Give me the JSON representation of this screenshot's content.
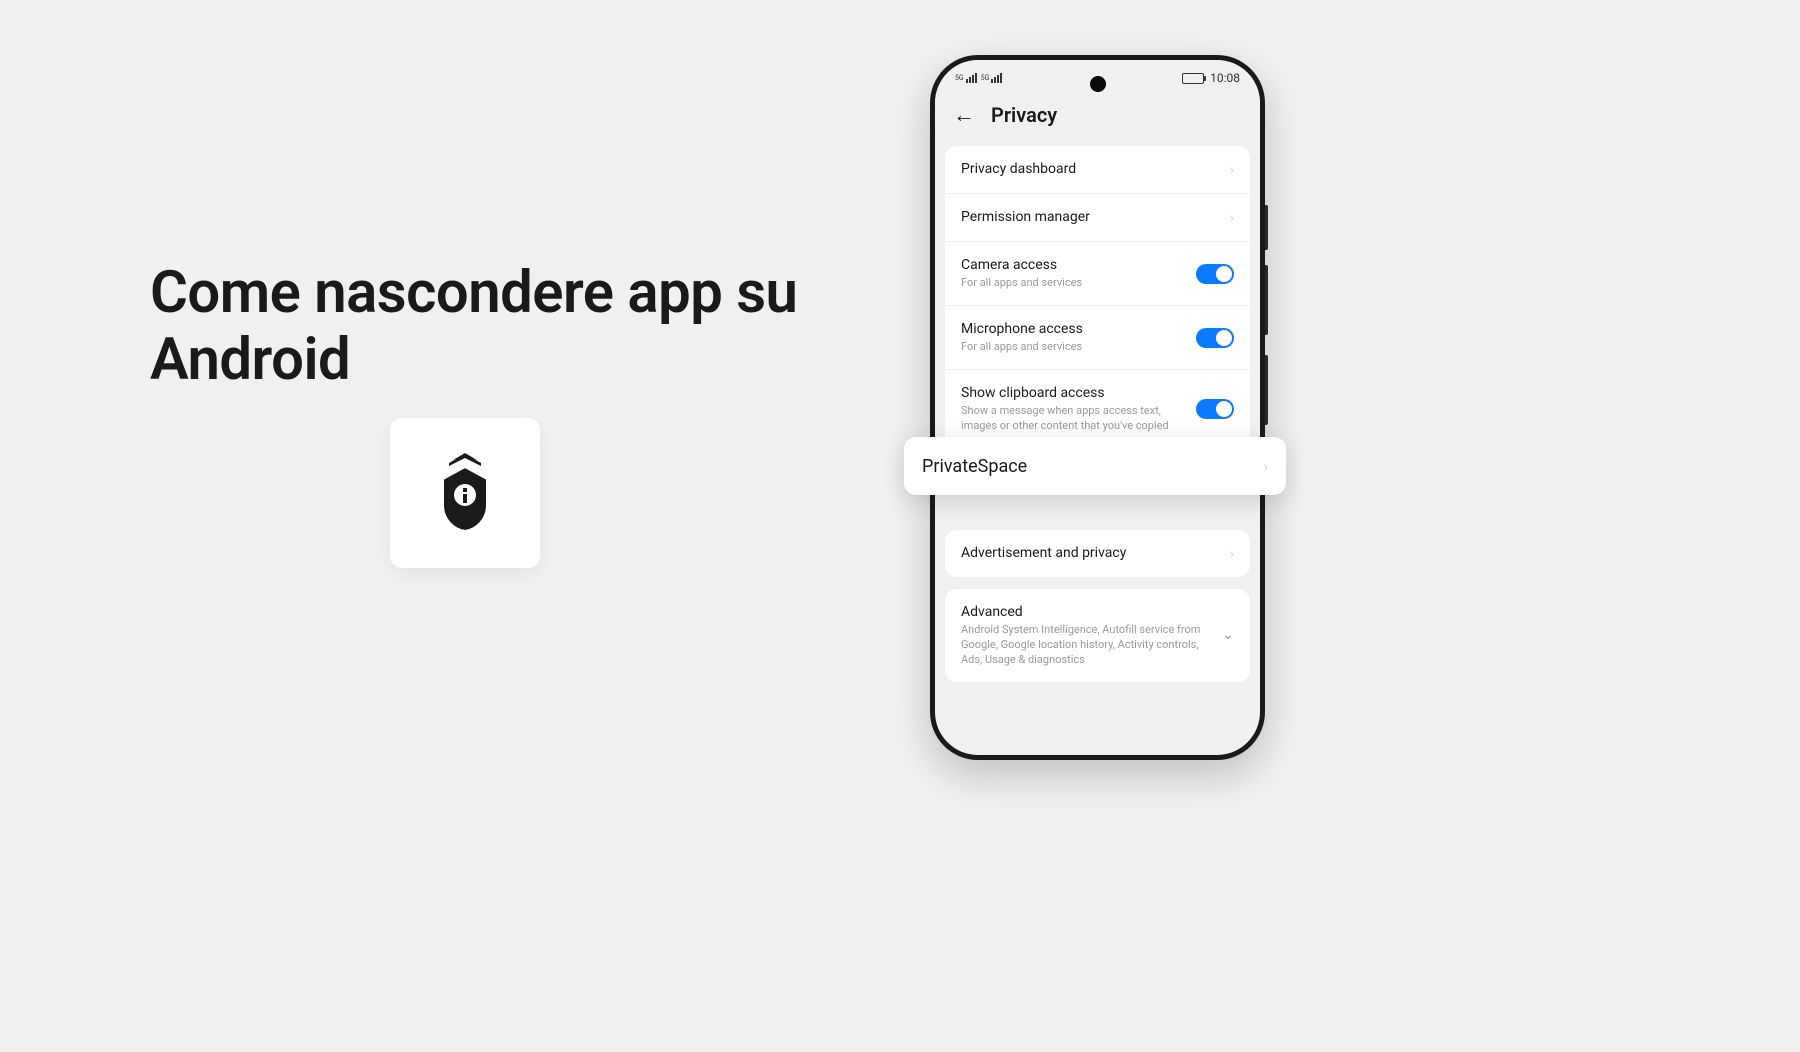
{
  "main": {
    "title": "Come nascondere app su Android"
  },
  "phone": {
    "status": {
      "time": "10:08"
    },
    "header": {
      "title": "Privacy"
    },
    "card1": {
      "privacy_dashboard": "Privacy dashboard",
      "permission_manager": "Permission manager",
      "camera_title": "Camera access",
      "camera_sub": "For all apps and services",
      "mic_title": "Microphone access",
      "mic_sub": "For all apps and services",
      "clipboard_title": "Show clipboard access",
      "clipboard_sub": "Show a message when apps access text, images or other content that you've copied"
    },
    "callout": {
      "title": "PrivateSpace"
    },
    "card3": {
      "ads": "Advertisement and privacy"
    },
    "card4": {
      "adv_title": "Advanced",
      "adv_sub": "Android System Intelligence, Autofill service from Google, Google location history, Activity controls, Ads, Usage & diagnostics"
    }
  }
}
